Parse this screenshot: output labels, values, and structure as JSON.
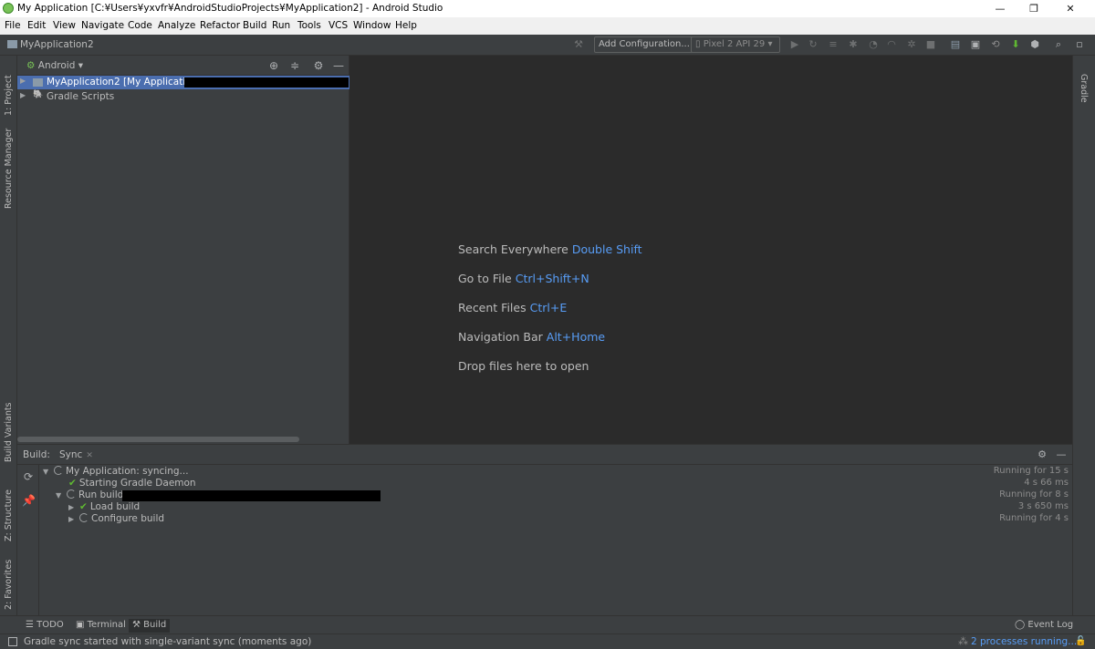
{
  "window": {
    "title": "My Application [C:¥Users¥yxvfr¥AndroidStudioProjects¥MyApplication2] - Android Studio",
    "minimize": "—",
    "restore": "❐",
    "close": "✕"
  },
  "menu": [
    "File",
    "Edit",
    "View",
    "Navigate",
    "Code",
    "Analyze",
    "Refactor",
    "Build",
    "Run",
    "Tools",
    "VCS",
    "Window",
    "Help"
  ],
  "navbar": {
    "project": "MyApplication2",
    "add_config": "Add Configuration...",
    "device": "Pixel 2 API 29"
  },
  "left_stripe": {
    "project": "1: Project",
    "resource_manager": "Resource Manager",
    "build_variants": "Build Variants",
    "structure": "Z: Structure",
    "favorites": "2: Favorites"
  },
  "right_stripe": {
    "gradle": "Gradle"
  },
  "project_panel": {
    "view_selector": "Android",
    "tree": [
      {
        "label": "MyApplication2 [My Application]"
      },
      {
        "label": "Gradle Scripts"
      }
    ]
  },
  "editor_hints": [
    {
      "text": "Search Everywhere",
      "key": "Double Shift"
    },
    {
      "text": "Go to File",
      "key": "Ctrl+Shift+N"
    },
    {
      "text": "Recent Files",
      "key": "Ctrl+E"
    },
    {
      "text": "Navigation Bar",
      "key": "Alt+Home"
    },
    {
      "text": "Drop files here to open",
      "key": ""
    }
  ],
  "build": {
    "label": "Build:",
    "tab": "Sync",
    "rows": [
      {
        "text": "My Application:",
        "suffix": " syncing...",
        "timing": "Running for 15 s"
      },
      {
        "text": "Starting Gradle Daemon",
        "suffix": "",
        "timing": "4 s 66 ms"
      },
      {
        "text": "Run build",
        "suffix": "",
        "timing": "Running for 8 s"
      },
      {
        "text": "Load build",
        "suffix": "",
        "timing": "3 s 650 ms"
      },
      {
        "text": "Configure build",
        "suffix": "",
        "timing": "Running for 4 s"
      }
    ]
  },
  "bottom_tabs": {
    "todo": "TODO",
    "terminal": "Terminal",
    "build": "Build",
    "event_log": "Event Log"
  },
  "status": {
    "message": "Gradle sync started with single-variant sync (moments ago)",
    "processes": "2 processes running..."
  }
}
